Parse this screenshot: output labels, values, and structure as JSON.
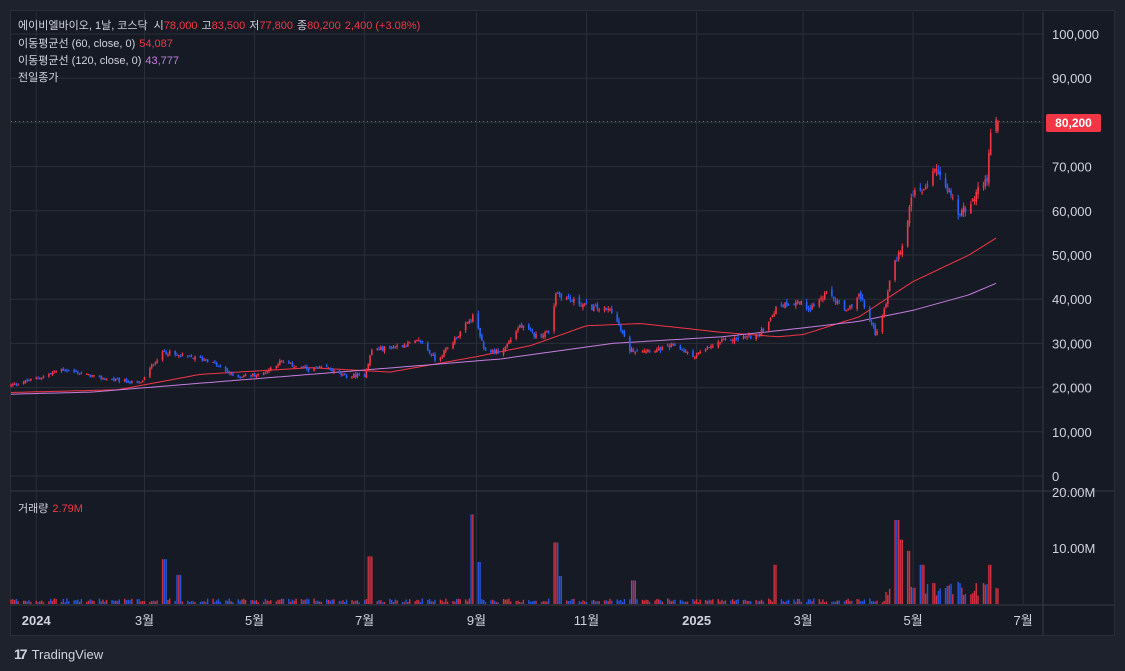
{
  "legend": {
    "ticker": "에이비엘바이오, 1날, 코스닥",
    "open_label": "시",
    "open": "78,000",
    "high_label": "고",
    "high": "83,500",
    "low_label": "저",
    "low": "77,800",
    "close_label": "종",
    "close": "80,200",
    "change": "2,400 (+3.08%)",
    "ma60_label": "이동평균선 (60, close, 0)",
    "ma60_value": "54,087",
    "ma120_label": "이동평균선 (120, close, 0)",
    "ma120_value": "43,777",
    "prev_close_label": "전일종가",
    "volume_label": "거래량",
    "volume_value": "2.79M"
  },
  "price_badge": "80,200",
  "brand": "TradingView",
  "colors": {
    "up": "#f23645",
    "down": "#2962ff",
    "ma60": "#f23645",
    "ma120": "#c77ddf",
    "background": "#161a25",
    "grid": "#2a2e39"
  },
  "chart_data": {
    "type": "candlestick",
    "price_axis": {
      "range": [
        0,
        100000
      ],
      "ticks": [
        0,
        10000,
        20000,
        30000,
        40000,
        50000,
        60000,
        70000,
        80000,
        90000,
        100000
      ],
      "tick_labels": [
        "0",
        "10,000",
        "20,000",
        "30,000",
        "40,000",
        "50,000",
        "60,000",
        "70,000",
        "80,000",
        "90,000",
        "100,000"
      ]
    },
    "volume_axis": {
      "range": [
        0,
        20000000
      ],
      "ticks": [
        10000000,
        20000000
      ],
      "tick_labels": [
        "10.00M",
        "20.00M"
      ]
    },
    "time_axis": {
      "labels": [
        "2024",
        "3월",
        "5월",
        "7월",
        "9월",
        "11월",
        "2025",
        "3월",
        "5월",
        "7월"
      ],
      "label_dates": [
        "2024-01-01",
        "2024-03-01",
        "2024-05-01",
        "2024-07-01",
        "2024-09-01",
        "2024-11-01",
        "2025-01-01",
        "2025-03-01",
        "2025-05-01",
        "2025-07-01"
      ],
      "range": [
        "2023-12-18",
        "2025-07-12"
      ]
    },
    "close_anchors": [
      [
        "2023-12-18",
        20500
      ],
      [
        "2024-01-05",
        22500
      ],
      [
        "2024-01-15",
        24200
      ],
      [
        "2024-02-05",
        22200
      ],
      [
        "2024-02-28",
        21000
      ],
      [
        "2024-03-06",
        25500
      ],
      [
        "2024-03-12",
        28200
      ],
      [
        "2024-03-18",
        27300
      ],
      [
        "2024-04-05",
        26300
      ],
      [
        "2024-04-20",
        22500
      ],
      [
        "2024-05-05",
        23000
      ],
      [
        "2024-05-15",
        25800
      ],
      [
        "2024-06-01",
        24000
      ],
      [
        "2024-06-10",
        24500
      ],
      [
        "2024-06-20",
        22500
      ],
      [
        "2024-07-01",
        22800
      ],
      [
        "2024-07-05",
        28500
      ],
      [
        "2024-07-15",
        29000
      ],
      [
        "2024-08-01",
        30500
      ],
      [
        "2024-08-10",
        26000
      ],
      [
        "2024-08-20",
        31000
      ],
      [
        "2024-08-31",
        36500
      ],
      [
        "2024-09-05",
        28500
      ],
      [
        "2024-09-15",
        28000
      ],
      [
        "2024-09-25",
        34000
      ],
      [
        "2024-10-05",
        31500
      ],
      [
        "2024-10-12",
        33000
      ],
      [
        "2024-10-15",
        41500
      ],
      [
        "2024-10-25",
        39500
      ],
      [
        "2024-11-05",
        38000
      ],
      [
        "2024-11-15",
        37500
      ],
      [
        "2024-11-25",
        28500
      ],
      [
        "2024-12-10",
        28500
      ],
      [
        "2024-12-20",
        29500
      ],
      [
        "2024-12-30",
        27000
      ],
      [
        "2025-01-15",
        30500
      ],
      [
        "2025-02-05",
        32000
      ],
      [
        "2025-02-15",
        38500
      ],
      [
        "2025-02-25",
        39500
      ],
      [
        "2025-03-05",
        38000
      ],
      [
        "2025-03-15",
        41500
      ],
      [
        "2025-03-25",
        37000
      ],
      [
        "2025-04-01",
        41000
      ],
      [
        "2025-04-10",
        32500
      ],
      [
        "2025-04-14",
        35500
      ],
      [
        "2025-04-20",
        47500
      ],
      [
        "2025-04-25",
        52000
      ],
      [
        "2025-05-01",
        64000
      ],
      [
        "2025-05-06",
        63500
      ],
      [
        "2025-05-12",
        69000
      ],
      [
        "2025-05-18",
        67500
      ],
      [
        "2025-05-26",
        59500
      ],
      [
        "2025-06-02",
        61000
      ],
      [
        "2025-06-07",
        66000
      ],
      [
        "2025-06-11",
        67000
      ],
      [
        "2025-06-14",
        82500
      ],
      [
        "2025-06-17",
        80200
      ]
    ],
    "ma60_anchors": [
      [
        "2023-12-18",
        18900
      ],
      [
        "2024-02-15",
        19500
      ],
      [
        "2024-04-01",
        23000
      ],
      [
        "2024-06-01",
        24500
      ],
      [
        "2024-07-15",
        23500
      ],
      [
        "2024-09-01",
        27000
      ],
      [
        "2024-10-01",
        29500
      ],
      [
        "2024-11-01",
        34000
      ],
      [
        "2024-12-01",
        34500
      ],
      [
        "2025-01-15",
        32500
      ],
      [
        "2025-02-15",
        31500
      ],
      [
        "2025-03-01",
        32000
      ],
      [
        "2025-04-01",
        36000
      ],
      [
        "2025-05-01",
        44000
      ],
      [
        "2025-06-01",
        50000
      ],
      [
        "2025-06-17",
        54087
      ]
    ],
    "ma120_anchors": [
      [
        "2023-12-18",
        18500
      ],
      [
        "2024-02-01",
        19000
      ],
      [
        "2024-04-01",
        21000
      ],
      [
        "2024-06-01",
        23000
      ],
      [
        "2024-08-01",
        25000
      ],
      [
        "2024-09-15",
        26500
      ],
      [
        "2024-11-15",
        30000
      ],
      [
        "2025-01-15",
        31500
      ],
      [
        "2025-03-01",
        33500
      ],
      [
        "2025-04-01",
        35000
      ],
      [
        "2025-05-01",
        37500
      ],
      [
        "2025-06-01",
        41000
      ],
      [
        "2025-06-17",
        43777
      ]
    ],
    "prev_close": 77800,
    "last_close": 80200,
    "volume_spikes": [
      [
        "2024-03-12",
        8000000
      ],
      [
        "2024-03-20",
        5200000
      ],
      [
        "2024-07-04",
        8500000
      ],
      [
        "2024-08-30",
        16000000
      ],
      [
        "2024-09-02",
        7500000
      ],
      [
        "2024-10-15",
        11000000
      ],
      [
        "2024-10-17",
        5000000
      ],
      [
        "2024-11-27",
        4200000
      ],
      [
        "2025-02-14",
        7000000
      ],
      [
        "2025-04-22",
        15000000
      ],
      [
        "2025-04-24",
        11500000
      ],
      [
        "2025-04-28",
        9500000
      ],
      [
        "2025-05-06",
        7000000
      ],
      [
        "2025-06-13",
        7000000
      ]
    ]
  }
}
